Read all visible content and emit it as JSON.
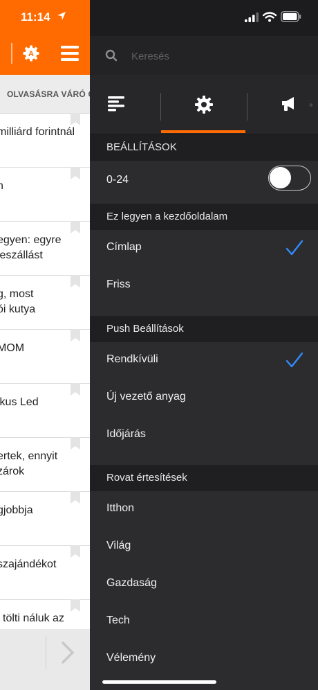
{
  "status_bar": {
    "time": "11:14"
  },
  "left_panel": {
    "tab_label": "OLVASÁSRA VÁRÓ CI",
    "articles": [
      "milliárd forintnál",
      "n",
      "egyen: egyre\nleszállást",
      "g, most\nói kutya",
      "MOM",
      "ikus Led",
      "ertek, ennyit\nzárok",
      "gjobbja",
      "szajándékot",
      "l tölti náluk az"
    ]
  },
  "search": {
    "placeholder": "Keresés"
  },
  "tabs": [
    {
      "icon": "list-icon",
      "active": false
    },
    {
      "icon": "gear-icon",
      "active": true
    },
    {
      "icon": "megaphone-icon",
      "active": false
    }
  ],
  "settings": {
    "section_settings": "BEÁLLÍTÁSOK",
    "row_024": {
      "label": "0-24",
      "toggle_on": false
    },
    "section_home": "Ez legyen a kezdőoldalam",
    "home_options": [
      {
        "label": "Címlap",
        "checked": true
      },
      {
        "label": "Friss",
        "checked": false
      }
    ],
    "section_push": "Push Beállítások",
    "push_options": [
      {
        "label": "Rendkívüli",
        "checked": true
      },
      {
        "label": "Új vezető anyag",
        "checked": false
      },
      {
        "label": "Időjárás",
        "checked": false
      }
    ],
    "section_rovat": "Rovat értesítések",
    "rovat_options": [
      {
        "label": "Itthon"
      },
      {
        "label": "Világ"
      },
      {
        "label": "Gazdaság"
      },
      {
        "label": "Tech"
      },
      {
        "label": "Vélemény"
      }
    ]
  },
  "colors": {
    "accent": "#ff6b00",
    "check": "#2f8cff",
    "drawer_bg": "#2c2c2e",
    "section_bg": "#1f1f21"
  }
}
